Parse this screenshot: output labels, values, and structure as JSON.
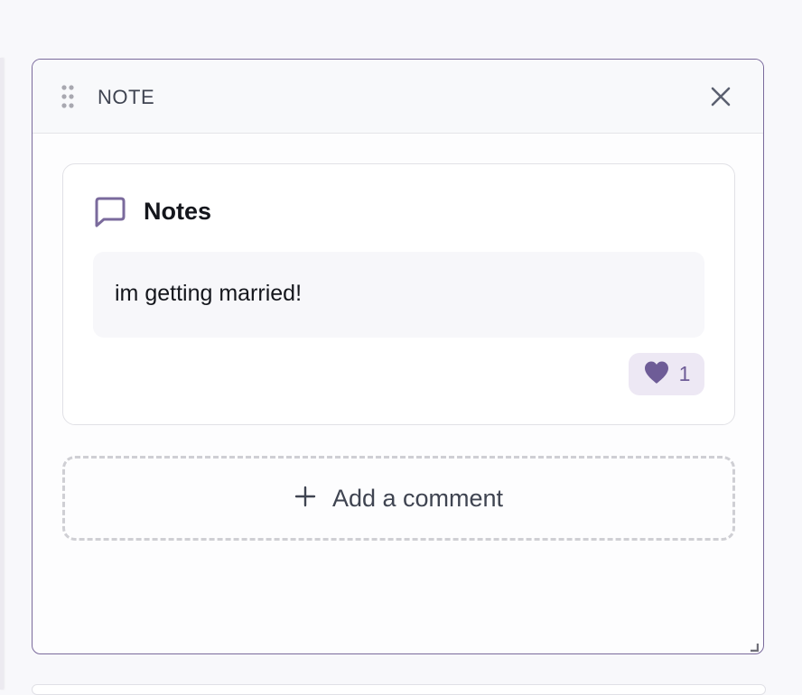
{
  "panel": {
    "title": "NOTE",
    "close_icon": "close-icon",
    "drag_icon": "drag-handle-icon",
    "border_color": "#7a6a9c"
  },
  "note": {
    "heading": "Notes",
    "icon": "chat-bubble-icon",
    "body": "im getting married!",
    "reaction": {
      "icon": "heart-icon",
      "count": "1",
      "color": "#6e5c97"
    }
  },
  "comment": {
    "add_label": "Add a comment",
    "icon": "plus-icon"
  }
}
